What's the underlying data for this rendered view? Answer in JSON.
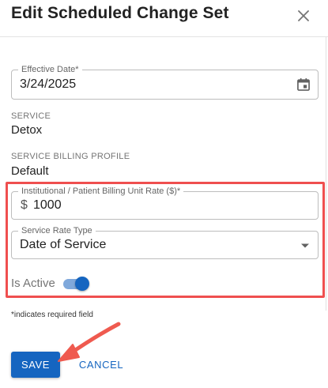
{
  "dialog": {
    "title": "Edit Scheduled Change Set"
  },
  "effective_date": {
    "label": "Effective Date*",
    "value": "3/24/2025"
  },
  "service": {
    "label": "SERVICE",
    "value": "Detox"
  },
  "billing_profile": {
    "label": "SERVICE BILLING PROFILE",
    "value": "Default"
  },
  "rate": {
    "label": "Institutional / Patient Billing Unit Rate ($)*",
    "prefix": "$",
    "value": "1000"
  },
  "rate_type": {
    "label": "Service Rate Type",
    "value": "Date of Service"
  },
  "is_active": {
    "label": "Is Active",
    "checked": true
  },
  "required_note": "*indicates required field",
  "actions": {
    "save_label": "SAVE",
    "cancel_label": "CANCEL"
  },
  "colors": {
    "primary": "#1565c0",
    "highlight": "#ef4f4f"
  },
  "icons": {
    "close": "close-icon",
    "calendar": "calendar-icon",
    "dropdown": "caret-down-icon"
  }
}
